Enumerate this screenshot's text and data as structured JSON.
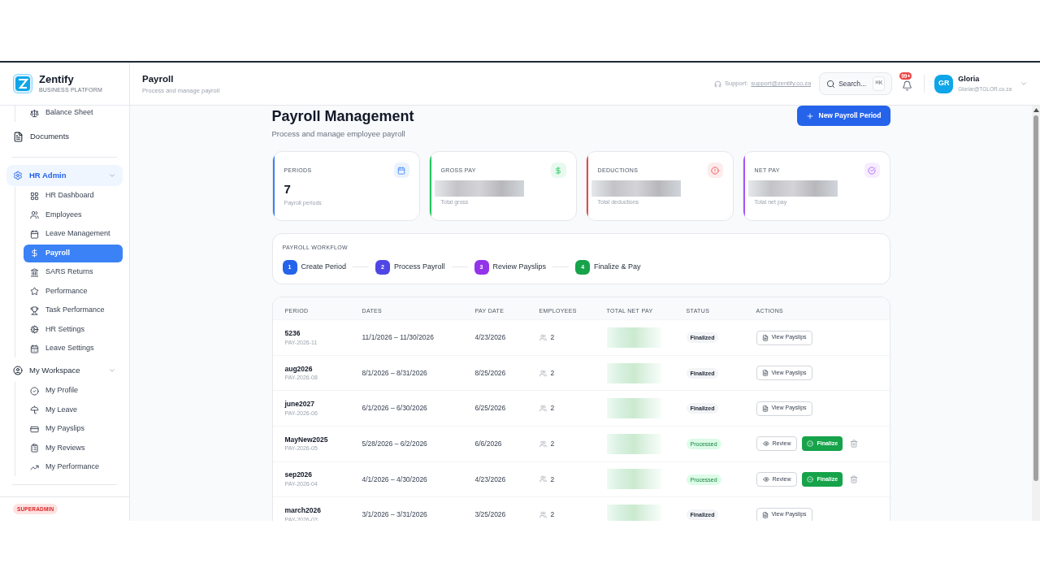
{
  "brand": {
    "name": "Zentify",
    "tagline": "BUSINESS PLATFORM"
  },
  "sidebar": {
    "items": [
      {
        "kind": "child",
        "label": "Balance Sheet",
        "selected": false
      },
      {
        "kind": "item",
        "label": "Documents",
        "selected": false
      },
      {
        "kind": "divider"
      },
      {
        "kind": "group",
        "label": "HR Admin",
        "expanded": true,
        "highlighted": true,
        "children": [
          {
            "label": "HR Dashboard",
            "selected": false
          },
          {
            "label": "Employees",
            "selected": false
          },
          {
            "label": "Leave Management",
            "selected": false
          },
          {
            "label": "Payroll",
            "selected": true
          },
          {
            "label": "SARS Returns",
            "selected": false
          },
          {
            "label": "Performance",
            "selected": false
          },
          {
            "label": "Task Performance",
            "selected": false
          },
          {
            "label": "HR Settings",
            "selected": false
          },
          {
            "label": "Leave Settings",
            "selected": false
          }
        ]
      },
      {
        "kind": "group",
        "label": "My Workspace",
        "expanded": true,
        "highlighted": false,
        "children": [
          {
            "label": "My Profile",
            "selected": false
          },
          {
            "label": "My Leave",
            "selected": false
          },
          {
            "label": "My Payslips",
            "selected": false
          },
          {
            "label": "My Reviews",
            "selected": false
          },
          {
            "label": "My Performance",
            "selected": false
          }
        ]
      },
      {
        "kind": "divider"
      }
    ],
    "role_badge": "SUPERADMIN"
  },
  "header": {
    "title": "Payroll",
    "subtitle": "Process and manage payroll",
    "support_label": "Support:",
    "support_email": "support@zentify.co.za",
    "search_placeholder": "Search...",
    "shortcut": "⌘K",
    "notifications": "99+",
    "user": {
      "initials": "GR",
      "name": "Gloria",
      "email": "Gloriar@TGLOR.co.za"
    }
  },
  "page": {
    "title": "Payroll Management",
    "subtitle": "Process and manage employee payroll",
    "new_button": "New Payroll Period"
  },
  "stats": [
    {
      "label": "PERIODS",
      "value": "7",
      "caption": "Payroll periods",
      "color": "#3b82f6",
      "redacted": false
    },
    {
      "label": "GROSS PAY",
      "caption": "Total gross",
      "color": "#22c55e",
      "redacted": true
    },
    {
      "label": "DEDUCTIONS",
      "caption": "Total deductions",
      "color": "#ef4444",
      "redacted": true
    },
    {
      "label": "NET PAY",
      "caption": "Total net pay",
      "color": "#a855f7",
      "redacted": true
    }
  ],
  "workflow": {
    "title": "PAYROLL WORKFLOW",
    "steps": [
      {
        "number": "1",
        "label": "Create Period",
        "color": "#2563eb"
      },
      {
        "number": "2",
        "label": "Process Payroll",
        "color": "#4f46e5"
      },
      {
        "number": "3",
        "label": "Review Payslips",
        "color": "#9333ea"
      },
      {
        "number": "4",
        "label": "Finalize & Pay",
        "color": "#16a34a"
      }
    ]
  },
  "table": {
    "columns": [
      "PERIOD",
      "DATES",
      "PAY DATE",
      "EMPLOYEES",
      "TOTAL NET PAY",
      "STATUS",
      "ACTIONS"
    ],
    "rows": [
      {
        "period": "5236",
        "code": "PAY-2026-11",
        "dates": "11/1/2026 – 11/30/2026",
        "pay_date": "4/23/2026",
        "employees": "2",
        "status": {
          "text": "Finalized",
          "kind": "finalized"
        },
        "actions": [
          {
            "kind": "view",
            "label": "View Payslips"
          }
        ],
        "deletable": false
      },
      {
        "period": "aug2026",
        "code": "PAY-2026-08",
        "dates": "8/1/2026 – 8/31/2026",
        "pay_date": "8/25/2026",
        "employees": "2",
        "status": {
          "text": "Finalized",
          "kind": "finalized"
        },
        "actions": [
          {
            "kind": "view",
            "label": "View Payslips"
          }
        ],
        "deletable": false
      },
      {
        "period": "june2027",
        "code": "PAY-2026-06",
        "dates": "6/1/2026 – 6/30/2026",
        "pay_date": "6/25/2026",
        "employees": "2",
        "status": {
          "text": "Finalized",
          "kind": "finalized"
        },
        "actions": [
          {
            "kind": "view",
            "label": "View Payslips"
          }
        ],
        "deletable": false
      },
      {
        "period": "MayNew2025",
        "code": "PAY-2026-05",
        "dates": "5/28/2026 – 6/2/2026",
        "pay_date": "6/6/2026",
        "employees": "2",
        "status": {
          "text": "Processed",
          "kind": "processed"
        },
        "actions": [
          {
            "kind": "review",
            "label": "Review"
          },
          {
            "kind": "finalize",
            "label": "Finalize"
          }
        ],
        "deletable": true
      },
      {
        "period": "sep2026",
        "code": "PAY-2026-04",
        "dates": "4/1/2026 – 4/30/2026",
        "pay_date": "4/23/2026",
        "employees": "2",
        "status": {
          "text": "Processed",
          "kind": "processed"
        },
        "actions": [
          {
            "kind": "review",
            "label": "Review"
          },
          {
            "kind": "finalize",
            "label": "Finalize"
          }
        ],
        "deletable": true
      },
      {
        "period": "march2026",
        "code": "PAY-2026-03",
        "dates": "3/1/2026 – 3/31/2026",
        "pay_date": "3/25/2026",
        "employees": "2",
        "status": {
          "text": "Finalized",
          "kind": "finalized"
        },
        "actions": [
          {
            "kind": "view",
            "label": "View Payslips"
          }
        ],
        "deletable": false
      }
    ]
  }
}
